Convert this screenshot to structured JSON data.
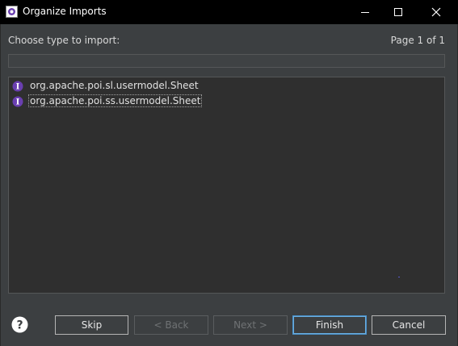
{
  "window": {
    "title": "Organize Imports",
    "icon": "gear-icon",
    "controls": [
      "minimize-icon",
      "maximize-icon",
      "close-icon"
    ]
  },
  "dialog": {
    "prompt": "Choose type to import:",
    "page_info": "Page 1 of 1",
    "filter_value": ""
  },
  "list": {
    "items": [
      {
        "label": "org.apache.poi.sl.usermodel.Sheet",
        "icon": "interface-icon",
        "selected": false
      },
      {
        "label": "org.apache.poi.ss.usermodel.Sheet",
        "icon": "interface-icon",
        "selected": true
      }
    ]
  },
  "buttons": {
    "skip": "Skip",
    "back": "< Back",
    "next": "Next >",
    "finish": "Finish",
    "cancel": "Cancel"
  },
  "colors": {
    "titlebar": "#000000",
    "background": "#3c3f41",
    "list_bg": "#2f2f2f",
    "interface_icon": "#6a3fb0",
    "default_button_border": "#4a90c8"
  }
}
